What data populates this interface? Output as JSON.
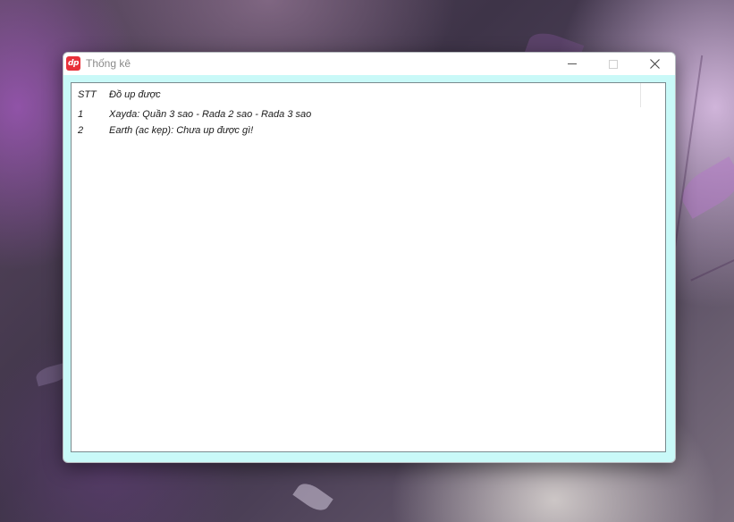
{
  "window": {
    "title": "Thống kê",
    "app_icon_text": "dp"
  },
  "table": {
    "columns": [
      "STT",
      "Đồ up được"
    ],
    "rows": [
      {
        "stt": "1",
        "item": "Xayda: Quần 3 sao - Rada 2 sao - Rada 3 sao"
      },
      {
        "stt": "2",
        "item": "Earth (ac kẹp): Chưa up được gì!"
      }
    ]
  },
  "colors": {
    "window_frame": "#c9f9f8",
    "titlebar": "#ffffff",
    "app_icon": "#e8313a"
  },
  "icons": {
    "app": "dp-app-icon",
    "minimize": "minimize-icon",
    "maximize": "maximize-icon",
    "close": "close-icon"
  }
}
